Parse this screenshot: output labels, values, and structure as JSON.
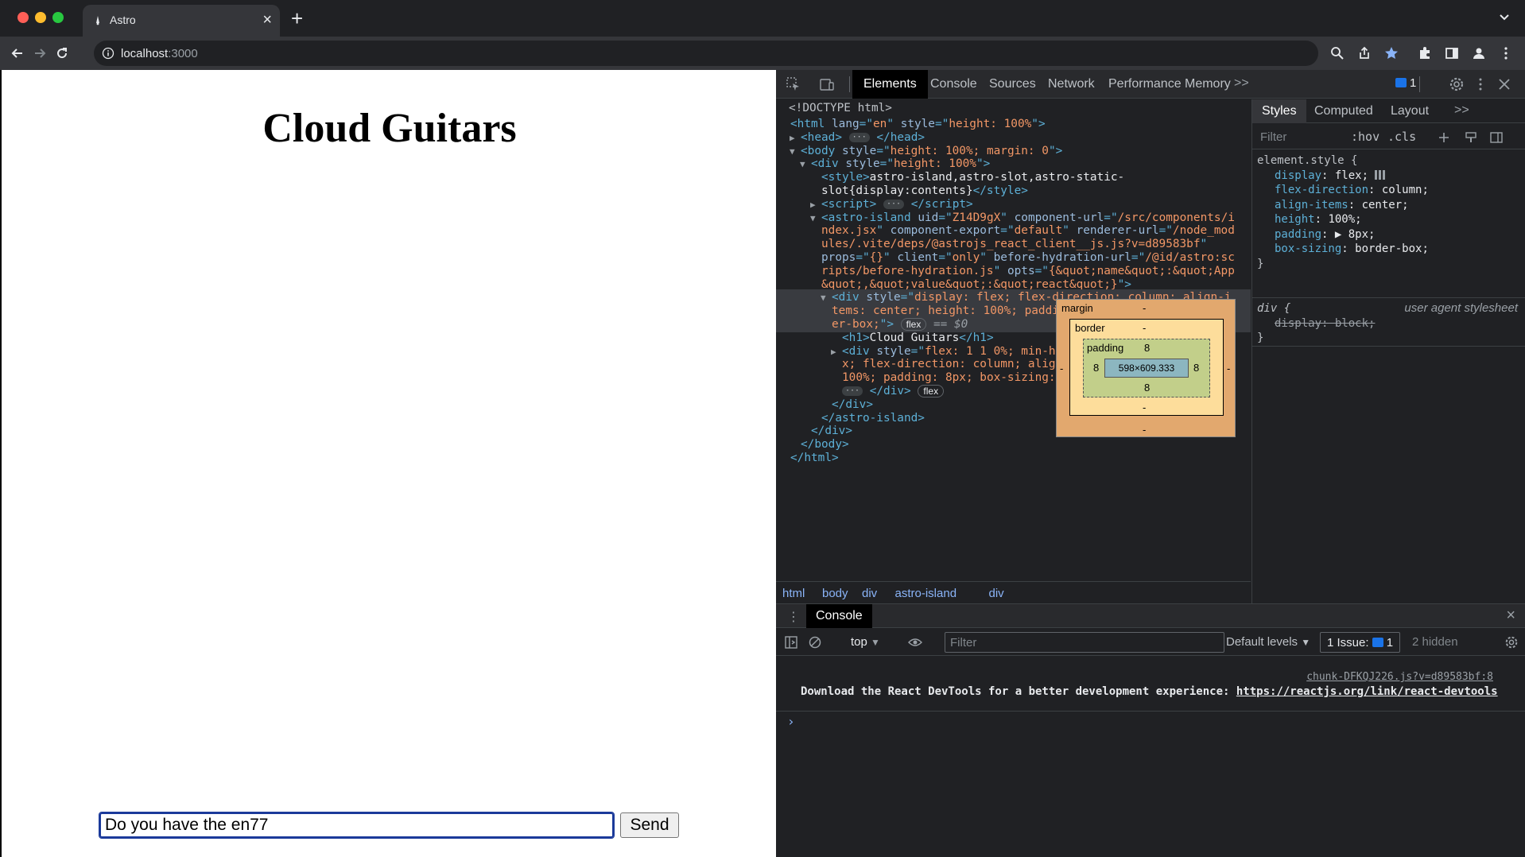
{
  "browser": {
    "tab_title": "Astro",
    "url_host": "localhost",
    "url_port": ":3000"
  },
  "page": {
    "heading": "Cloud Guitars",
    "input_value": "Do you have the en77",
    "send_label": "Send"
  },
  "devtools": {
    "tabs": [
      "Elements",
      "Console",
      "Sources",
      "Network",
      "Performance",
      "Memory"
    ],
    "more": ">>",
    "issues_count": "1",
    "dom": {
      "doctype": "<!DOCTYPE html>",
      "lines": [
        {
          "tri": "",
          "ind": 0,
          "html": "<span class='tag'>&lt;html</span> <span class='attr'>lang</span><span class='tag'>=\"</span><span class='val'>en</span><span class='tag'>\"</span> <span class='attr'>style</span><span class='tag'>=\"</span><span class='val'>height: 100%</span><span class='tag'>\"&gt;</span>"
        },
        {
          "tri": "▶",
          "ind": 1,
          "html": "<span class='tag'>&lt;head&gt;</span> <span class='ellip'>···</span> <span class='tag'>&lt;/head&gt;</span>"
        },
        {
          "tri": "▼",
          "ind": 1,
          "html": "<span class='tag'>&lt;body</span> <span class='attr'>style</span><span class='tag'>=\"</span><span class='val'>height: 100%; margin: 0</span><span class='tag'>\"&gt;</span>"
        },
        {
          "tri": "▼",
          "ind": 2,
          "html": "<span class='tag'>&lt;div</span> <span class='attr'>style</span><span class='tag'>=\"</span><span class='val'>height: 100%</span><span class='tag'>\"&gt;</span>"
        },
        {
          "tri": "",
          "ind": 3,
          "html": "<span class='tag'>&lt;style&gt;</span><span class='txt'>astro-island,astro-slot,astro-static-</span>"
        },
        {
          "tri": "",
          "ind": 3,
          "html": "<span class='txt'>slot{display:contents}</span><span class='tag'>&lt;/style&gt;</span>"
        },
        {
          "tri": "▶",
          "ind": 3,
          "html": "<span class='tag'>&lt;script&gt;</span> <span class='ellip'>···</span> <span class='tag'>&lt;/script&gt;</span>"
        },
        {
          "tri": "▼",
          "ind": 3,
          "html": "<span class='tag'>&lt;astro-island</span> <span class='attr'>uid</span><span class='tag'>=\"</span><span class='val'>Z14D9gX</span><span class='tag'>\"</span> <span class='attr'>component-url</span><span class='tag'>=\"</span><span class='val'>/src/components/i</span>"
        },
        {
          "tri": "",
          "ind": 3,
          "html": "<span class='val'>ndex.jsx</span><span class='tag'>\"</span> <span class='attr'>component-export</span><span class='tag'>=\"</span><span class='val'>default</span><span class='tag'>\"</span> <span class='attr'>renderer-url</span><span class='tag'>=\"</span><span class='val'>/node_mod</span>"
        },
        {
          "tri": "",
          "ind": 3,
          "html": "<span class='val'>ules/.vite/deps/@astrojs_react_client__js.js?v=d89583bf</span><span class='tag'>\"</span>"
        },
        {
          "tri": "",
          "ind": 3,
          "html": "<span class='attr'>props</span><span class='tag'>=\"</span><span class='val'>{}</span><span class='tag'>\"</span> <span class='attr'>client</span><span class='tag'>=\"</span><span class='val'>only</span><span class='tag'>\"</span> <span class='attr'>before-hydration-url</span><span class='tag'>=\"</span><span class='val'>/@id/astro:sc</span>"
        },
        {
          "tri": "",
          "ind": 3,
          "html": "<span class='val'>ripts/before-hydration.js</span><span class='tag'>\"</span> <span class='attr'>opts</span><span class='tag'>=\"</span><span class='val'>{&amp;quot;name&amp;quot;:&amp;quot;App</span>"
        },
        {
          "tri": "",
          "ind": 3,
          "html": "<span class='val'>&amp;quot;,&amp;quot;value&amp;quot;:&amp;quot;react&amp;quot;}</span><span class='tag'>\"&gt;</span>"
        },
        {
          "tri": "▼",
          "ind": 4,
          "sel": true,
          "html": "<span class='tag'>&lt;div</span> <span class='attr'>style</span><span class='tag'>=\"</span><span class='val'>display: flex; flex-direction: column; align-i</span>"
        },
        {
          "tri": "",
          "ind": 4,
          "sel": true,
          "html": "<span class='val'>tems: center; height: 100%; padding: 8px; box-sizing: bord</span>"
        },
        {
          "tri": "",
          "ind": 4,
          "sel": true,
          "html": "<span class='val'>er-box;</span><span class='tag'>\"&gt;</span> <span class='pill'>flex</span> <span class='dollar0'>== $0</span>"
        },
        {
          "tri": "",
          "ind": 5,
          "html": "<span class='tag'>&lt;h1&gt;</span><span class='txt'>Cloud Guitars</span><span class='tag'>&lt;/h1&gt;</span>"
        },
        {
          "tri": "▶",
          "ind": 5,
          "html": "<span class='tag'>&lt;div</span> <span class='attr'>style</span><span class='tag'>=\"</span><span class='val'>flex: 1 1 0%; min-height: 0px; display: fle</span>"
        },
        {
          "tri": "",
          "ind": 5,
          "html": "<span class='val'>x; flex-direction: column; align-items: center; height:</span>"
        },
        {
          "tri": "",
          "ind": 5,
          "html": "<span class='val'>100%; padding: 8px; box-sizing: border-box; gap: 4px;</span><span class='tag'>\"&gt;</span>"
        },
        {
          "tri": "",
          "ind": 5,
          "html": "<span class='ellip'>···</span> <span class='tag'>&lt;/div&gt;</span> <span class='pill'>flex</span>"
        },
        {
          "tri": "",
          "ind": 4,
          "html": "<span class='tag'>&lt;/div&gt;</span>"
        },
        {
          "tri": "",
          "ind": 3,
          "html": "<span class='tag'>&lt;/astro-island&gt;</span>"
        },
        {
          "tri": "",
          "ind": 2,
          "html": "<span class='tag'>&lt;/div&gt;</span>"
        },
        {
          "tri": "",
          "ind": 1,
          "html": "<span class='tag'>&lt;/body&gt;</span>"
        },
        {
          "tri": "",
          "ind": 0,
          "html": "<span class='tag'>&lt;/html&gt;</span>"
        }
      ]
    },
    "breadcrumbs": [
      "html",
      "body",
      "div",
      "astro-island",
      "div"
    ],
    "styles": {
      "tabs": [
        "Styles",
        "Computed",
        "Layout"
      ],
      "more": ">>",
      "filter_placeholder": "Filter",
      "hov": ":hov",
      "cls": ".cls",
      "element_selector": "element.style {",
      "element_props": [
        {
          "name": "display",
          "value": "flex;"
        },
        {
          "name": "flex-direction",
          "value": "column;"
        },
        {
          "name": "align-items",
          "value": "center;"
        },
        {
          "name": "height",
          "value": "100%;"
        },
        {
          "name": "padding",
          "value": "▶ 8px;"
        },
        {
          "name": "box-sizing",
          "value": "border-box;"
        }
      ],
      "close_brace": "}",
      "ua_selector": "div {",
      "ua_label": "user agent stylesheet",
      "ua_prop": "display: block;",
      "box": {
        "margin_label": "margin",
        "margin_value": "-",
        "border_label": "border",
        "border_value": "-",
        "padding_label": "padding",
        "padding_value": "8",
        "content": "598×609.333",
        "side_left": "8",
        "side_right": "8",
        "outer_left": "-",
        "outer_right": "-"
      }
    },
    "console": {
      "tab": "Console",
      "context": "top",
      "filter_placeholder": "Filter",
      "levels": "Default levels",
      "issues_label": "1 Issue:",
      "issues_count": "1",
      "hidden": "2 hidden",
      "source": "chunk-DFKQJ226.js?v=d89583bf:8",
      "message": "Download the React DevTools for a better development experience: ",
      "link": "https://reactjs.org/link/react-devtools",
      "prompt": "›"
    }
  }
}
